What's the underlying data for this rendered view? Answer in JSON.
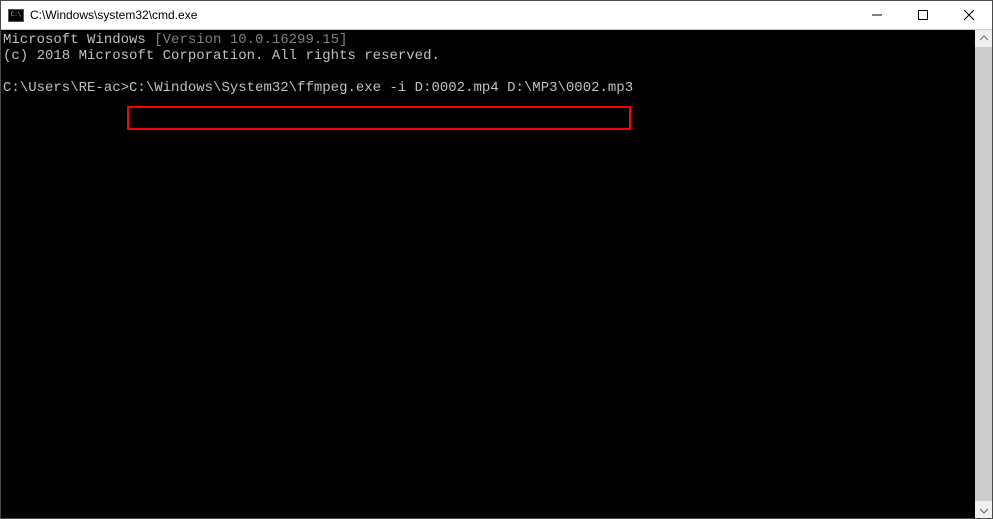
{
  "titlebar": {
    "title": "C:\\Windows\\system32\\cmd.exe"
  },
  "terminal": {
    "line1_a": "Microsoft Windows",
    "line1_b": "[Version 10.0.16299.15]",
    "line2_a": "(c) 2018 Microsoft Corporation.",
    "line2_b": "All rights reserved.",
    "prompt": "C:\\Users\\RE-ac>",
    "command": "C:\\Windows\\System32\\ffmpeg.exe -i D:0002.mp4 D:\\MP3\\0002.mp3"
  }
}
